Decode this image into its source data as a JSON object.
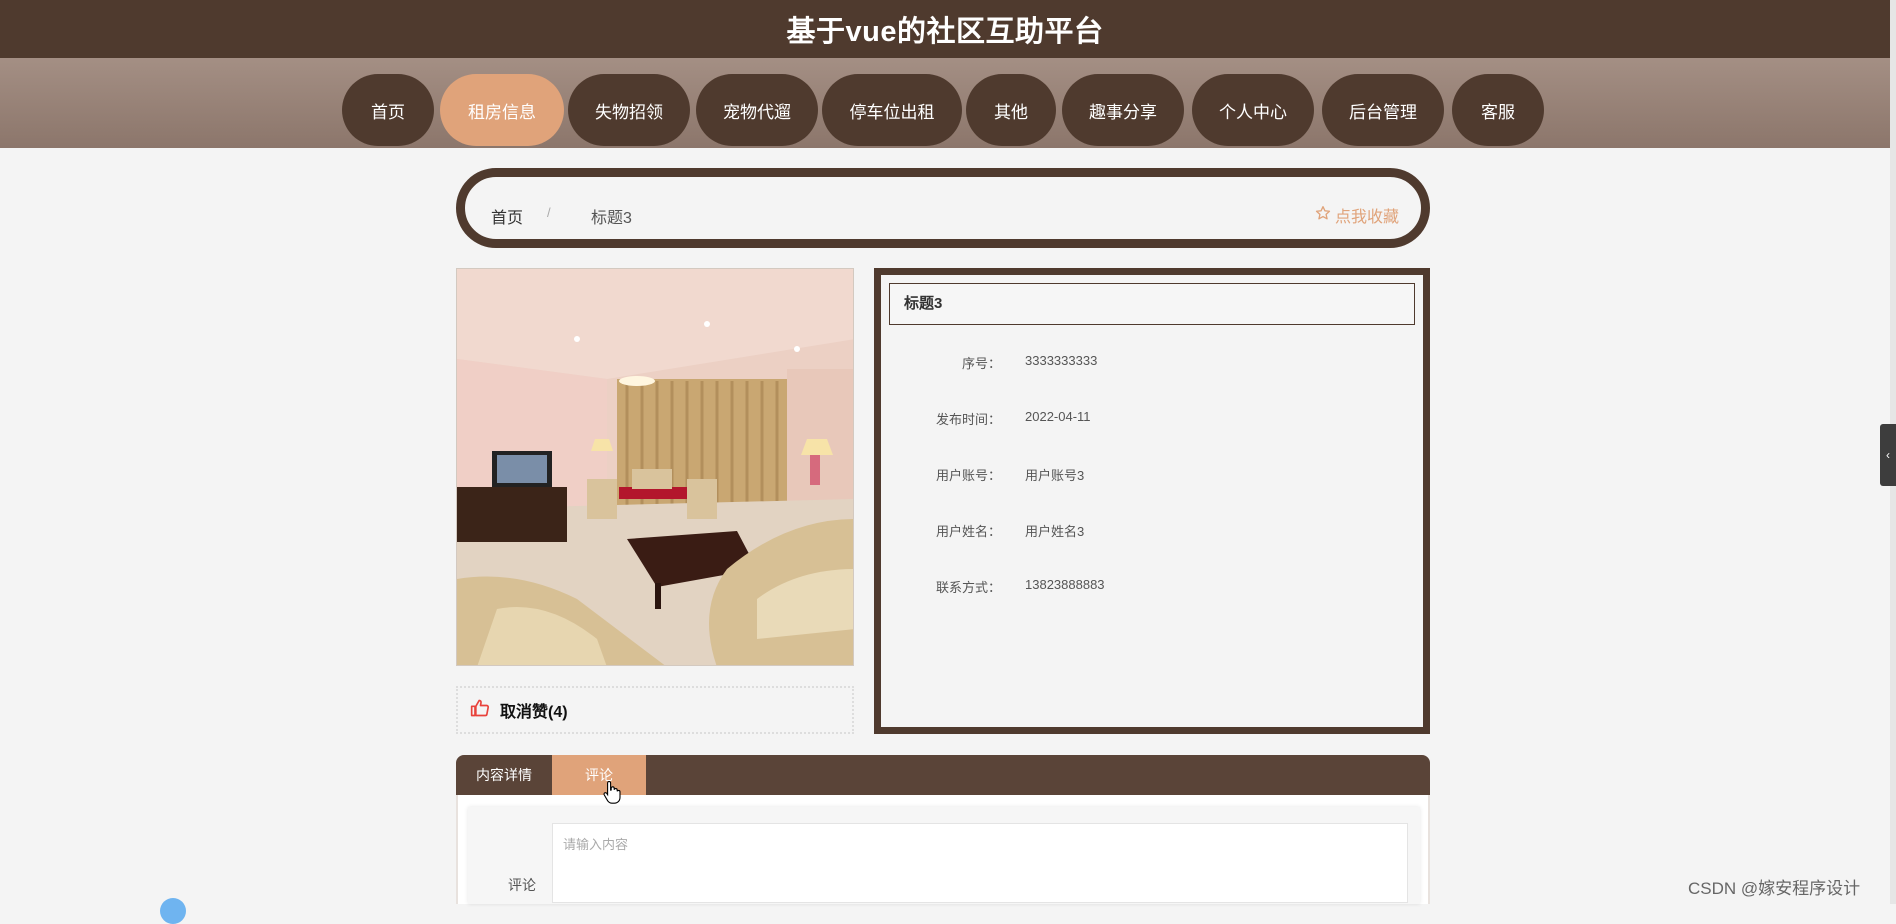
{
  "site": {
    "title": "基于vue的社区互助平台"
  },
  "nav": {
    "items": [
      {
        "label": "首页"
      },
      {
        "label": "租房信息"
      },
      {
        "label": "失物招领"
      },
      {
        "label": "宠物代遛"
      },
      {
        "label": "停车位出租"
      },
      {
        "label": "其他"
      },
      {
        "label": "趣事分享"
      },
      {
        "label": "个人中心"
      },
      {
        "label": "后台管理"
      },
      {
        "label": "客服"
      }
    ],
    "active_index": 1
  },
  "breadcrumb": {
    "home": "首页",
    "separator": "/",
    "current": "标题3"
  },
  "favorite": {
    "label": "点我收藏",
    "icon": "star-outline-icon"
  },
  "like": {
    "label": "取消赞(4)",
    "icon": "thumbs-up-icon"
  },
  "detail": {
    "title": "标题3",
    "fields": [
      {
        "label": "序号：",
        "value": "3333333333"
      },
      {
        "label": "发布时间：",
        "value": "2022-04-11"
      },
      {
        "label": "用户账号：",
        "value": "用户账号3"
      },
      {
        "label": "用户姓名：",
        "value": "用户姓名3"
      },
      {
        "label": "联系方式：",
        "value": "13823888883"
      }
    ]
  },
  "tabs": [
    {
      "label": "内容详情"
    },
    {
      "label": "评论"
    }
  ],
  "active_tab": 1,
  "comment": {
    "label": "评论",
    "placeholder": "请输入内容"
  },
  "watermark": "CSDN @嫁安程序设计",
  "colors": {
    "brown": "#4f3a2e",
    "accent": "#e0a37a",
    "nav_bg": "#9a847a"
  }
}
